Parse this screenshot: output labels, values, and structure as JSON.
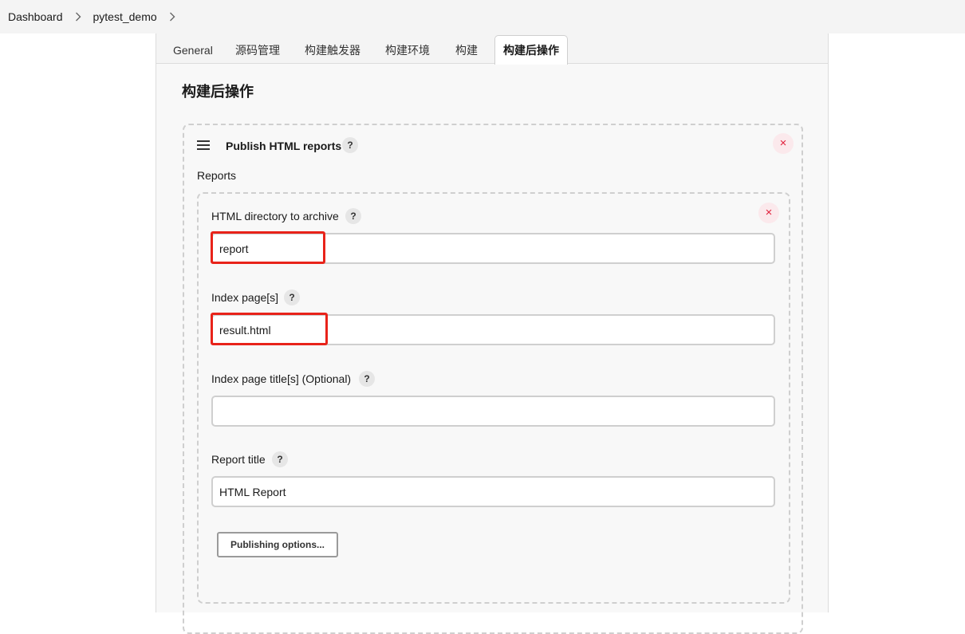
{
  "breadcrumb": {
    "items": [
      "Dashboard",
      "pytest_demo"
    ]
  },
  "tabs": [
    {
      "label": "General",
      "active": false
    },
    {
      "label": "源码管理",
      "active": false
    },
    {
      "label": "构建触发器",
      "active": false
    },
    {
      "label": "构建环境",
      "active": false
    },
    {
      "label": "构建",
      "active": false
    },
    {
      "label": "构建后操作",
      "active": true
    }
  ],
  "section": {
    "title": "构建后操作"
  },
  "publisher": {
    "title": "Publish HTML reports",
    "help": "?",
    "close": "×",
    "reports_label": "Reports",
    "report": {
      "close": "×",
      "fields": [
        {
          "label": "HTML directory to archive",
          "help": "?",
          "value": "report"
        },
        {
          "label": "Index page[s]",
          "help": "?",
          "value": "result.html"
        },
        {
          "label": "Index page title[s] (Optional)",
          "help": "?",
          "value": ""
        },
        {
          "label": "Report title",
          "help": "?",
          "value": "HTML Report"
        }
      ],
      "publishing_options_label": "Publishing options..."
    }
  },
  "colors": {
    "highlight": "#e8231a",
    "close_icon": "#e0213d",
    "close_bg": "#fbe9ec"
  }
}
